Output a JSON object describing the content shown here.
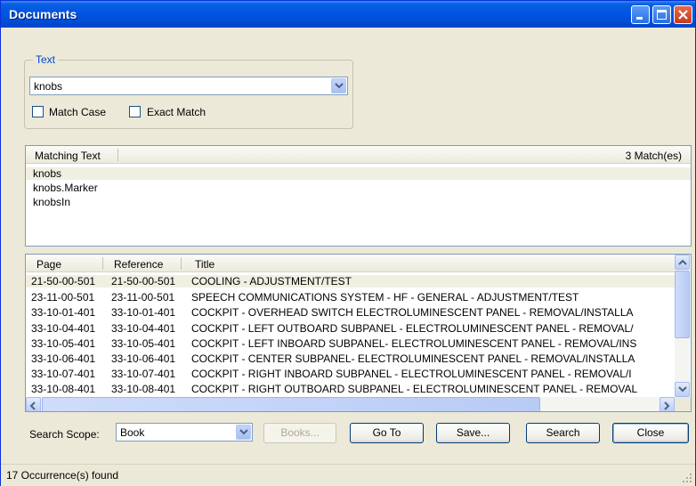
{
  "window": {
    "title": "Documents"
  },
  "text_group": {
    "label": "Text",
    "search_value": "knobs",
    "match_case_label": "Match Case",
    "exact_match_label": "Exact Match"
  },
  "matching": {
    "header": "Matching Text",
    "count": "3 Match(es)",
    "items": [
      "knobs",
      "knobs.Marker",
      "knobsIn"
    ]
  },
  "results": {
    "columns": [
      "Page",
      "Reference",
      "Title"
    ],
    "rows": [
      [
        "21-50-00-501",
        "21-50-00-501",
        "COOLING - ADJUSTMENT/TEST"
      ],
      [
        "23-11-00-501",
        "23-11-00-501",
        "SPEECH COMMUNICATIONS SYSTEM - HF - GENERAL - ADJUSTMENT/TEST"
      ],
      [
        "33-10-01-401",
        "33-10-01-401",
        "COCKPIT - OVERHEAD SWITCH ELECTROLUMINESCENT PANEL - REMOVAL/INSTALLA"
      ],
      [
        "33-10-04-401",
        "33-10-04-401",
        "COCKPIT - LEFT OUTBOARD SUBPANEL - ELECTROLUMINESCENT PANEL - REMOVAL/"
      ],
      [
        "33-10-05-401",
        "33-10-05-401",
        "COCKPIT - LEFT INBOARD SUBPANEL- ELECTROLUMINESCENT PANEL - REMOVAL/INS"
      ],
      [
        "33-10-06-401",
        "33-10-06-401",
        "COCKPIT - CENTER SUBPANEL- ELECTROLUMINESCENT PANEL - REMOVAL/INSTALLA"
      ],
      [
        "33-10-07-401",
        "33-10-07-401",
        "COCKPIT - RIGHT INBOARD SUBPANEL - ELECTROLUMINESCENT PANEL - REMOVAL/I"
      ],
      [
        "33-10-08-401",
        "33-10-08-401",
        "COCKPIT - RIGHT OUTBOARD SUBPANEL - ELECTROLUMINESCENT PANEL - REMOVAL"
      ]
    ]
  },
  "bottom": {
    "scope_label": "Search Scope:",
    "scope_value": "Book",
    "books_label": "Books...",
    "goto_label": "Go To",
    "save_label": "Save...",
    "search_label": "Search",
    "close_label": "Close"
  },
  "status": {
    "text": "17 Occurrence(s) found"
  }
}
